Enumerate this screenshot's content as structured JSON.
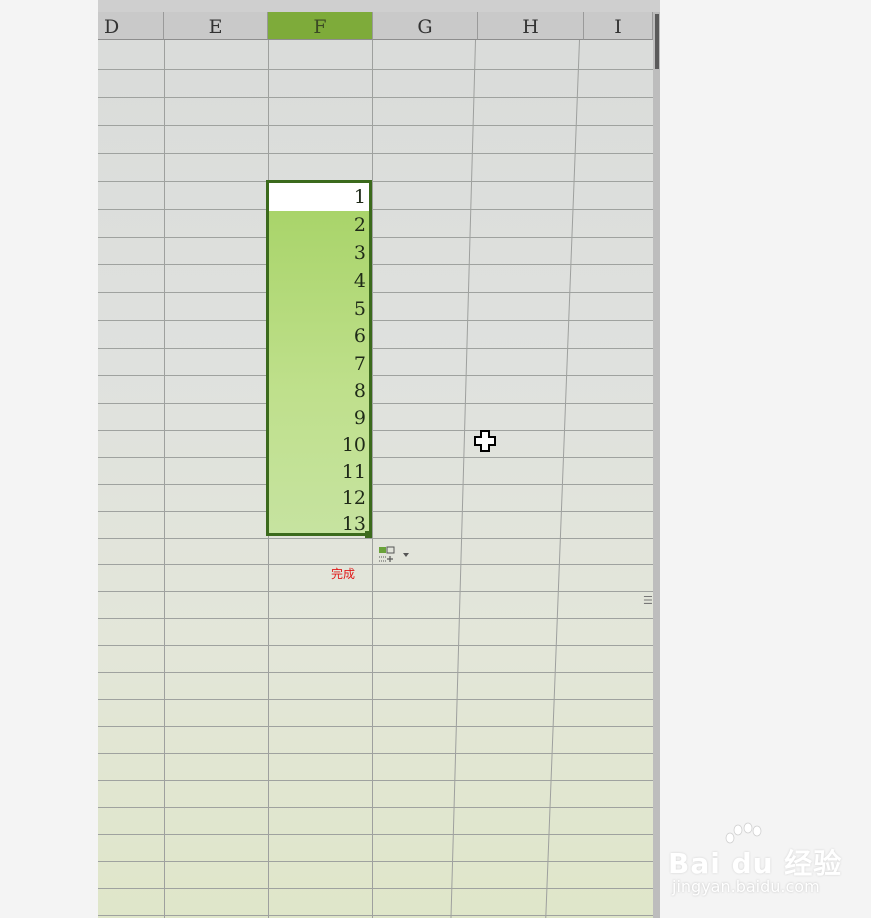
{
  "sheet": {
    "columns": [
      "D",
      "E",
      "F",
      "G",
      "H",
      "I"
    ],
    "selected_column": "F",
    "selected_values": [
      "1",
      "2",
      "3",
      "4",
      "5",
      "6",
      "7",
      "8",
      "9",
      "10",
      "11",
      "12",
      "13"
    ],
    "selection_color": "#a9d46a",
    "selection_border_color": "#3b6a1c"
  },
  "autofill": {
    "icon": "autofill-options-icon",
    "caption": "完成",
    "caption_color": "#e01818"
  },
  "cursor": {
    "icon": "plus-cross-cursor-icon"
  },
  "watermark": {
    "logo_text": "Bai du 经验",
    "url": "jingyan.baidu.com"
  }
}
